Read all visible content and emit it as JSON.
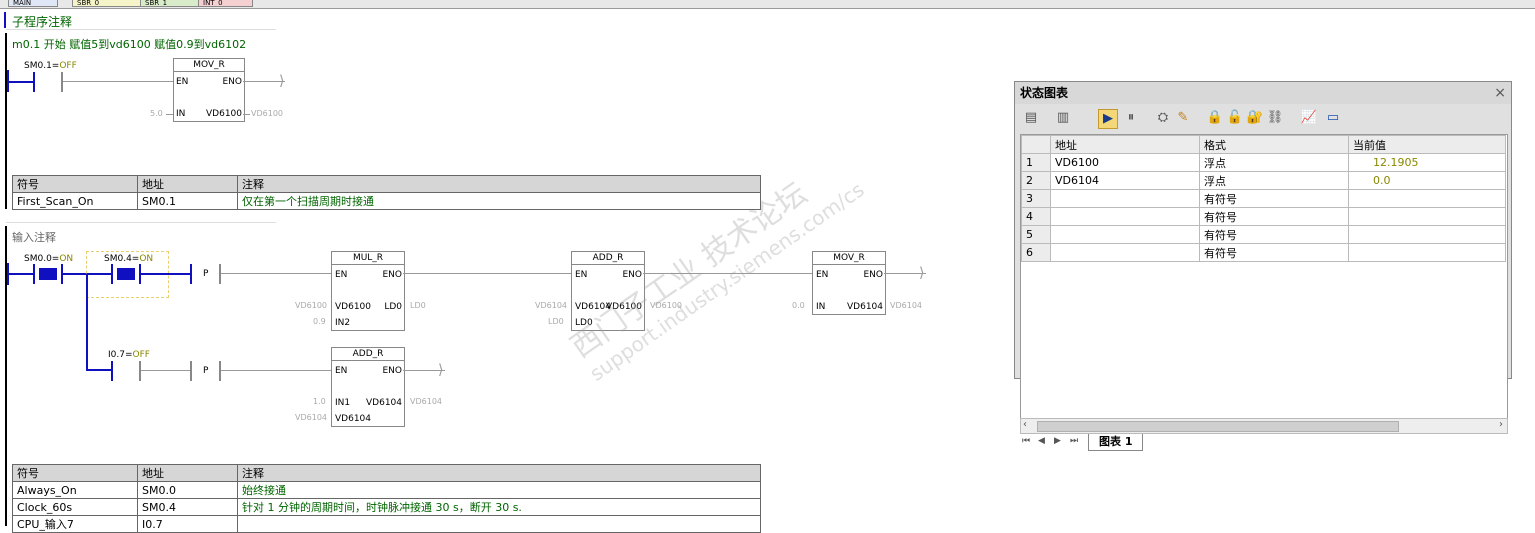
{
  "top_tabs": [
    "MAIN",
    "SBR_0",
    "SBR_1",
    "INT_0"
  ],
  "subroutine_comment": "子程序注释",
  "network1": {
    "comment": "m0.1 开始  赋值5到vd6100     赋值0.9到vd6102",
    "contact_addr": "SM0.1",
    "contact_eq": "=",
    "contact_state": "OFF",
    "box": {
      "title": "MOV_R",
      "en": "EN",
      "eno": "ENO",
      "in_pin": "IN",
      "out_pin": "VD6100",
      "in_val": "5.0",
      "out_val": "VD6100"
    },
    "symbols": {
      "headers": [
        "符号",
        "地址",
        "注释"
      ],
      "rows": [
        [
          "First_Scan_On",
          "SM0.1",
          "仅在第一个扫描周期时接通"
        ]
      ]
    }
  },
  "network2": {
    "comment": "输入注释",
    "c1_addr": "SM0.0",
    "c1_state": "ON",
    "c2_addr": "SM0.4",
    "c2_state": "ON",
    "c3_addr": "I0.7",
    "c3_state": "OFF",
    "eq": "=",
    "p_label": "P",
    "mul": {
      "title": "MUL_R",
      "en": "EN",
      "eno": "ENO",
      "in1": "VD6100",
      "in2": "IN2",
      "out": "LD0",
      "in1_val": "VD6100",
      "in2_val": "0.9",
      "out_val": "LD0"
    },
    "add1": {
      "title": "ADD_R",
      "en": "EN",
      "eno": "ENO",
      "in1": "VD6104",
      "in2": "LD0",
      "out": "VD6100",
      "in1_val": "VD6104",
      "in2_val": "LD0",
      "out_val": "VD6100"
    },
    "mov": {
      "title": "MOV_R",
      "en": "EN",
      "eno": "ENO",
      "in_pin": "IN",
      "out": "VD6104",
      "in_val": "0.0",
      "out_val": "VD6104"
    },
    "add2": {
      "title": "ADD_R",
      "en": "EN",
      "eno": "ENO",
      "in1": "IN1",
      "in2": "VD6104",
      "out": "VD6104",
      "in1_val": "1.0",
      "in2_val": "VD6104",
      "out_val": "VD6104"
    },
    "symbols": {
      "headers": [
        "符号",
        "地址",
        "注释"
      ],
      "rows": [
        [
          "Always_On",
          "SM0.0",
          "始终接通"
        ],
        [
          "Clock_60s",
          "SM0.4",
          "针对 1 分钟的周期时间，时钟脉冲接通 30 s，断开 30 s."
        ],
        [
          "CPU_输入7",
          "I0.7",
          ""
        ]
      ]
    }
  },
  "status_chart": {
    "title": "状态图表",
    "close": "×",
    "headers": [
      "",
      "地址",
      "格式",
      "当前值"
    ],
    "rows": [
      [
        "1",
        "VD6100",
        "浮点",
        "12.1905"
      ],
      [
        "2",
        "VD6104",
        "浮点",
        "0.0"
      ],
      [
        "3",
        "",
        "有符号",
        ""
      ],
      [
        "4",
        "",
        "有符号",
        ""
      ],
      [
        "5",
        "",
        "有符号",
        ""
      ],
      [
        "6",
        "",
        "有符号",
        ""
      ]
    ],
    "sheet_tab": "图表 1",
    "nav": [
      "⏮",
      "◀",
      "▶",
      "⏭"
    ]
  },
  "watermark": {
    "line1": "西门子工业 技术论坛",
    "line2": "support.industry.siemens.com/cs"
  },
  "colors": {
    "power_flow": "#1010c0",
    "state_text": "#888800",
    "comment_green": "#006400"
  }
}
